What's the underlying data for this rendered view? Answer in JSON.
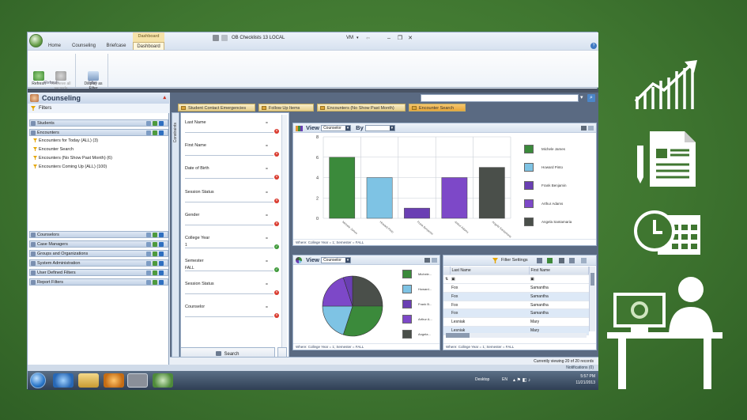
{
  "window": {
    "title": "OB Checklists 13 LOCAL",
    "user": "VM",
    "ribbon_tabs": [
      "Home",
      "Counseling",
      "Briefcase",
      "Dashboard"
    ],
    "contextual_tab": "Dashboard",
    "ribbon_buttons": [
      {
        "label": "Refresh"
      },
      {
        "label": "Retrieve all records"
      },
      {
        "label": "Display as Filter"
      }
    ],
    "ribbon_groups": [
      "Refresh",
      "Filter"
    ]
  },
  "left": {
    "title": "Counseling",
    "filters_label": "Filters",
    "sections": [
      {
        "label": "Students"
      },
      {
        "label": "Encounters",
        "items": [
          "Encounters for Today (ALL) (3)",
          "Encounter Search",
          "Encounters (No Show Past Month) (6)",
          "Encounters Coming Up (ALL) (100)"
        ]
      },
      {
        "label": "Counselors"
      },
      {
        "label": "Case Managers"
      },
      {
        "label": "Groups and Organizations"
      },
      {
        "label": "System Administration"
      },
      {
        "label": "User Defined Filters"
      },
      {
        "label": "Report Filters"
      }
    ]
  },
  "content": {
    "tabs": [
      "Student Contact Emergencies",
      "Follow Up Items",
      "Encounters (No Show Past Month)",
      "Encounter Search"
    ],
    "constraints_label": "Constraints",
    "form": {
      "fields": [
        {
          "label": "Last Name",
          "value": "",
          "state": "x"
        },
        {
          "label": "First Name",
          "value": "",
          "state": "x"
        },
        {
          "label": "Date of Birth",
          "value": "",
          "state": "x"
        },
        {
          "label": "Session Status",
          "value": "",
          "state": "x"
        },
        {
          "label": "Gender",
          "value": "",
          "state": "x"
        },
        {
          "label": "College Year",
          "value": "1",
          "state": "ok"
        },
        {
          "label": "Semester",
          "value": "FALL",
          "state": "ok"
        },
        {
          "label": "Session Status",
          "value": "",
          "state": "x"
        },
        {
          "label": "Counselor",
          "value": "",
          "state": "x"
        }
      ],
      "eq": "=",
      "search_label": "Search"
    },
    "bar_panel": {
      "view_label": "View",
      "view_value": "Counselor",
      "by_label": "By",
      "by_value": "",
      "footer": "Where: College Year = 1; Semester = FALL"
    },
    "pie_panel": {
      "view_label": "View",
      "view_value": "Counselor",
      "footer": "Where: College Year = 1; Semester = FALL",
      "legend": [
        "Michele...",
        "Howard...",
        "Frank B...",
        "Arthur A...",
        "Angela..."
      ]
    },
    "grid": {
      "toolbar_label": "Filter Settings",
      "columns": [
        "Last Name",
        "First Name"
      ],
      "rows": [
        [
          "Fox",
          "Samantha"
        ],
        [
          "Fox",
          "Samantha"
        ],
        [
          "Fox",
          "Samantha"
        ],
        [
          "Fox",
          "Samantha"
        ],
        [
          "Lesniak",
          "Mary"
        ],
        [
          "Lesniak",
          "Mary"
        ]
      ],
      "footer": "Where: College Year = 1; Semester = FALL"
    },
    "status": "Currently viewing 20 of 20 records"
  },
  "notifications": "Notifications (0)",
  "taskbar": {
    "desktop": "Desktop",
    "lang": "EN",
    "time": "5:57 PM",
    "date": "11/21/2013"
  },
  "colors": {
    "green": "#3b8a3b",
    "lightblue": "#7ec3e4",
    "purple": "#6a3fb3",
    "purple2": "#7d48c8",
    "darkgray": "#4a4f4a"
  },
  "chart_data": [
    {
      "type": "bar",
      "categories": [
        "Michele James",
        "Howard Pinto",
        "Frank Benjamin",
        "Arthur Adams",
        "Angela Santamaria"
      ],
      "values": [
        6,
        4,
        1,
        4,
        5
      ],
      "ylim": [
        0,
        8
      ],
      "yticks": [
        0,
        2,
        4,
        6,
        8
      ],
      "grid": true,
      "legend_placement": "right"
    },
    {
      "type": "pie",
      "labels": [
        "Michele James",
        "Howard Pinto",
        "Frank Benjamin",
        "Arthur Adams",
        "Angela Santamaria"
      ],
      "values": [
        6,
        4,
        1,
        4,
        5
      ],
      "legend_placement": "right"
    }
  ]
}
